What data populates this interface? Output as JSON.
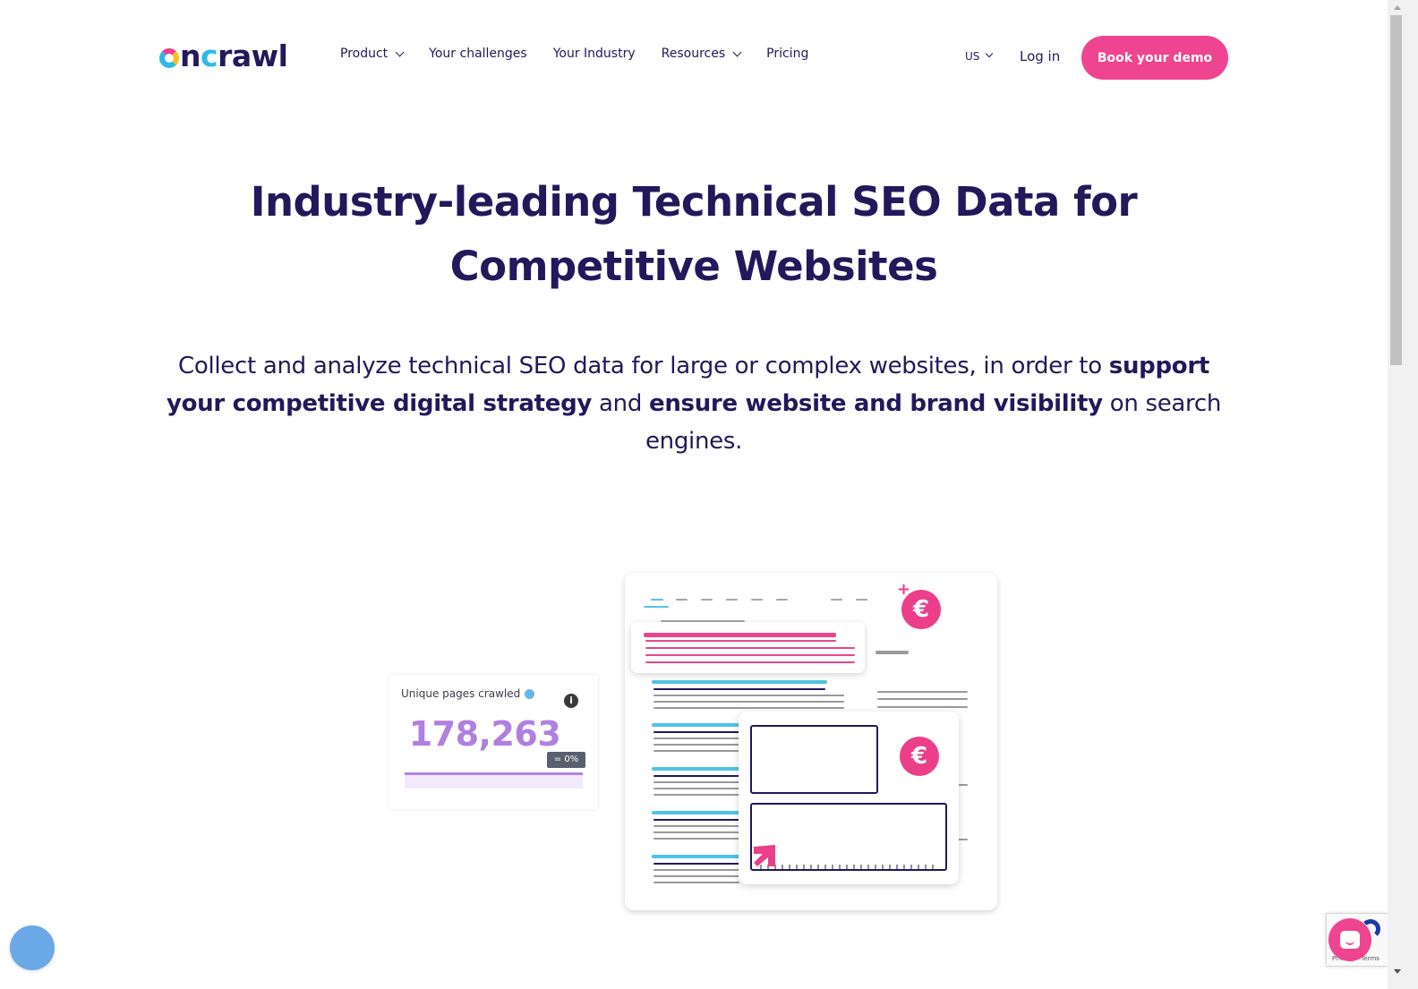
{
  "brand": {
    "logo_text_o": "",
    "logo_text_n": "n",
    "logo_text_c": "c",
    "logo_text_rest": "rawl",
    "accent_pink": "#ef4490",
    "navy": "#23185a",
    "cyan": "#2fb9e3",
    "yellow": "#f6c01c",
    "purple": "#b080e0"
  },
  "nav": {
    "items": [
      {
        "label": "Product",
        "has_dropdown": true
      },
      {
        "label": "Your challenges",
        "has_dropdown": false
      },
      {
        "label": "Your Industry",
        "has_dropdown": false
      },
      {
        "label": "Resources",
        "has_dropdown": true
      },
      {
        "label": "Pricing",
        "has_dropdown": false
      }
    ],
    "language": "US",
    "login_label": "Log in",
    "demo_label": "Book your demo"
  },
  "hero": {
    "title": "Industry-leading Technical SEO Data for Competitive Websites",
    "subtitle_part1": "Collect and analyze technical SEO data for large or complex websites, in order to ",
    "subtitle_bold1": "support your competitive digital strategy",
    "subtitle_part2": " and ",
    "subtitle_bold2": "ensure website and brand visibility",
    "subtitle_part3": " on search engines."
  },
  "illustration": {
    "stat_card": {
      "label": "Unique pages crawled",
      "info_glyph": "i",
      "value": "178,263",
      "change_badge": "= 0%"
    },
    "euro_glyph": "€",
    "plus_glyph": "+"
  },
  "widgets": {
    "recaptcha_text": "Privacy - Terms"
  }
}
